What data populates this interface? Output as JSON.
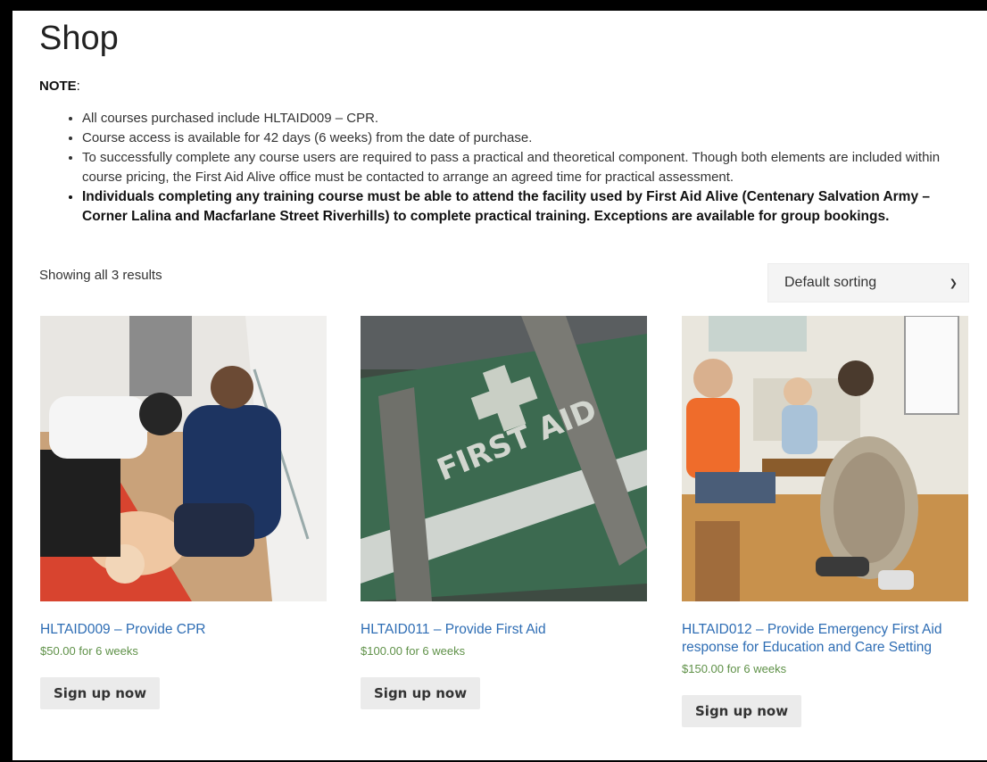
{
  "shop": {
    "title": "Shop",
    "note_label": "NOTE",
    "note_colon": ":",
    "notes": [
      "All courses purchased include HLTAID009 – CPR.",
      "Course access is available for 42 days (6 weeks) from the date of purchase.",
      "To successfully complete any course users are required to pass a practical and theoretical component. Though both elements are included within course pricing, the First Aid Alive office must be contacted to arrange an agreed time for practical assessment.",
      "Individuals completing any training course must be able to attend the facility used by First Aid Alive (Centenary Salvation Army – Corner Lalina and Macfarlane Street Riverhills) to complete practical training. Exceptions are available for group bookings."
    ],
    "result_count": "Showing all 3 results",
    "sorting": {
      "selected": "Default sorting"
    }
  },
  "products": [
    {
      "name": "HLTAID009 – Provide CPR",
      "price": "$50.00 for 6 weeks",
      "button": "Sign up now"
    },
    {
      "name": "HLTAID011 – Provide First Aid",
      "price": "$100.00 for 6 weeks",
      "button": "Sign up now"
    },
    {
      "name": "HLTAID012 – Provide Emergency First Aid response for Education and Care Setting",
      "price": "$150.00 for 6 weeks",
      "button": "Sign up now"
    }
  ],
  "image_text": {
    "bag_label": "FIRST AID"
  },
  "colors": {
    "link": "#2e6db4",
    "price": "#5f9148",
    "button_bg": "#ebebeb"
  }
}
